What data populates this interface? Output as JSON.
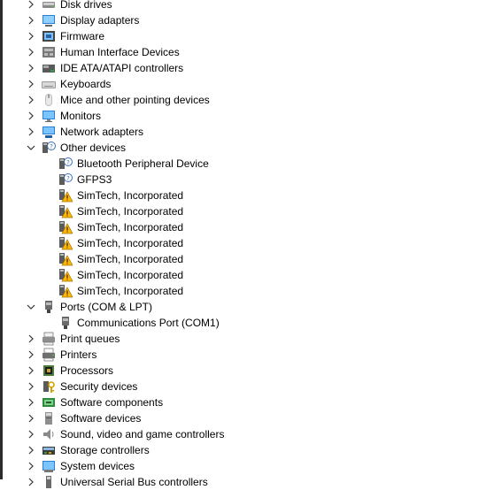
{
  "tree": [
    {
      "label": "Disk drives",
      "icon": "disk-drive-icon",
      "expanded": false
    },
    {
      "label": "Display adapters",
      "icon": "display-adapter-icon",
      "expanded": false
    },
    {
      "label": "Firmware",
      "icon": "firmware-icon",
      "expanded": false
    },
    {
      "label": "Human Interface Devices",
      "icon": "hid-icon",
      "expanded": false
    },
    {
      "label": "IDE ATA/ATAPI controllers",
      "icon": "ide-controller-icon",
      "expanded": false
    },
    {
      "label": "Keyboards",
      "icon": "keyboard-icon",
      "expanded": false
    },
    {
      "label": "Mice and other pointing devices",
      "icon": "mouse-icon",
      "expanded": false
    },
    {
      "label": "Monitors",
      "icon": "monitor-icon",
      "expanded": false
    },
    {
      "label": "Network adapters",
      "icon": "network-adapter-icon",
      "expanded": false
    },
    {
      "label": "Other devices",
      "icon": "unknown-device-icon",
      "expanded": true,
      "children": [
        {
          "label": "Bluetooth Peripheral Device",
          "icon": "unknown-device-icon",
          "status": "unknown"
        },
        {
          "label": "GFPS3",
          "icon": "unknown-device-icon",
          "status": "unknown"
        },
        {
          "label": "SimTech, Incorporated",
          "icon": "warning-device-icon",
          "status": "warning"
        },
        {
          "label": "SimTech, Incorporated",
          "icon": "warning-device-icon",
          "status": "warning"
        },
        {
          "label": "SimTech, Incorporated",
          "icon": "warning-device-icon",
          "status": "warning"
        },
        {
          "label": "SimTech, Incorporated",
          "icon": "warning-device-icon",
          "status": "warning"
        },
        {
          "label": "SimTech, Incorporated",
          "icon": "warning-device-icon",
          "status": "warning"
        },
        {
          "label": "SimTech, Incorporated",
          "icon": "warning-device-icon",
          "status": "warning"
        },
        {
          "label": "SimTech, Incorporated",
          "icon": "warning-device-icon",
          "status": "warning"
        }
      ]
    },
    {
      "label": "Ports (COM & LPT)",
      "icon": "port-icon",
      "expanded": true,
      "children": [
        {
          "label": "Communications Port (COM1)",
          "icon": "port-icon",
          "status": "ok"
        }
      ]
    },
    {
      "label": "Print queues",
      "icon": "print-queue-icon",
      "expanded": false
    },
    {
      "label": "Printers",
      "icon": "printer-icon",
      "expanded": false
    },
    {
      "label": "Processors",
      "icon": "processor-icon",
      "expanded": false
    },
    {
      "label": "Security devices",
      "icon": "security-device-icon",
      "expanded": false
    },
    {
      "label": "Software components",
      "icon": "software-component-icon",
      "expanded": false
    },
    {
      "label": "Software devices",
      "icon": "software-device-icon",
      "expanded": false
    },
    {
      "label": "Sound, video and game controllers",
      "icon": "speaker-icon",
      "expanded": false
    },
    {
      "label": "Storage controllers",
      "icon": "storage-controller-icon",
      "expanded": false
    },
    {
      "label": "System devices",
      "icon": "system-device-icon",
      "expanded": false
    },
    {
      "label": "Universal Serial Bus controllers",
      "icon": "usb-controller-icon",
      "expanded": false
    }
  ]
}
